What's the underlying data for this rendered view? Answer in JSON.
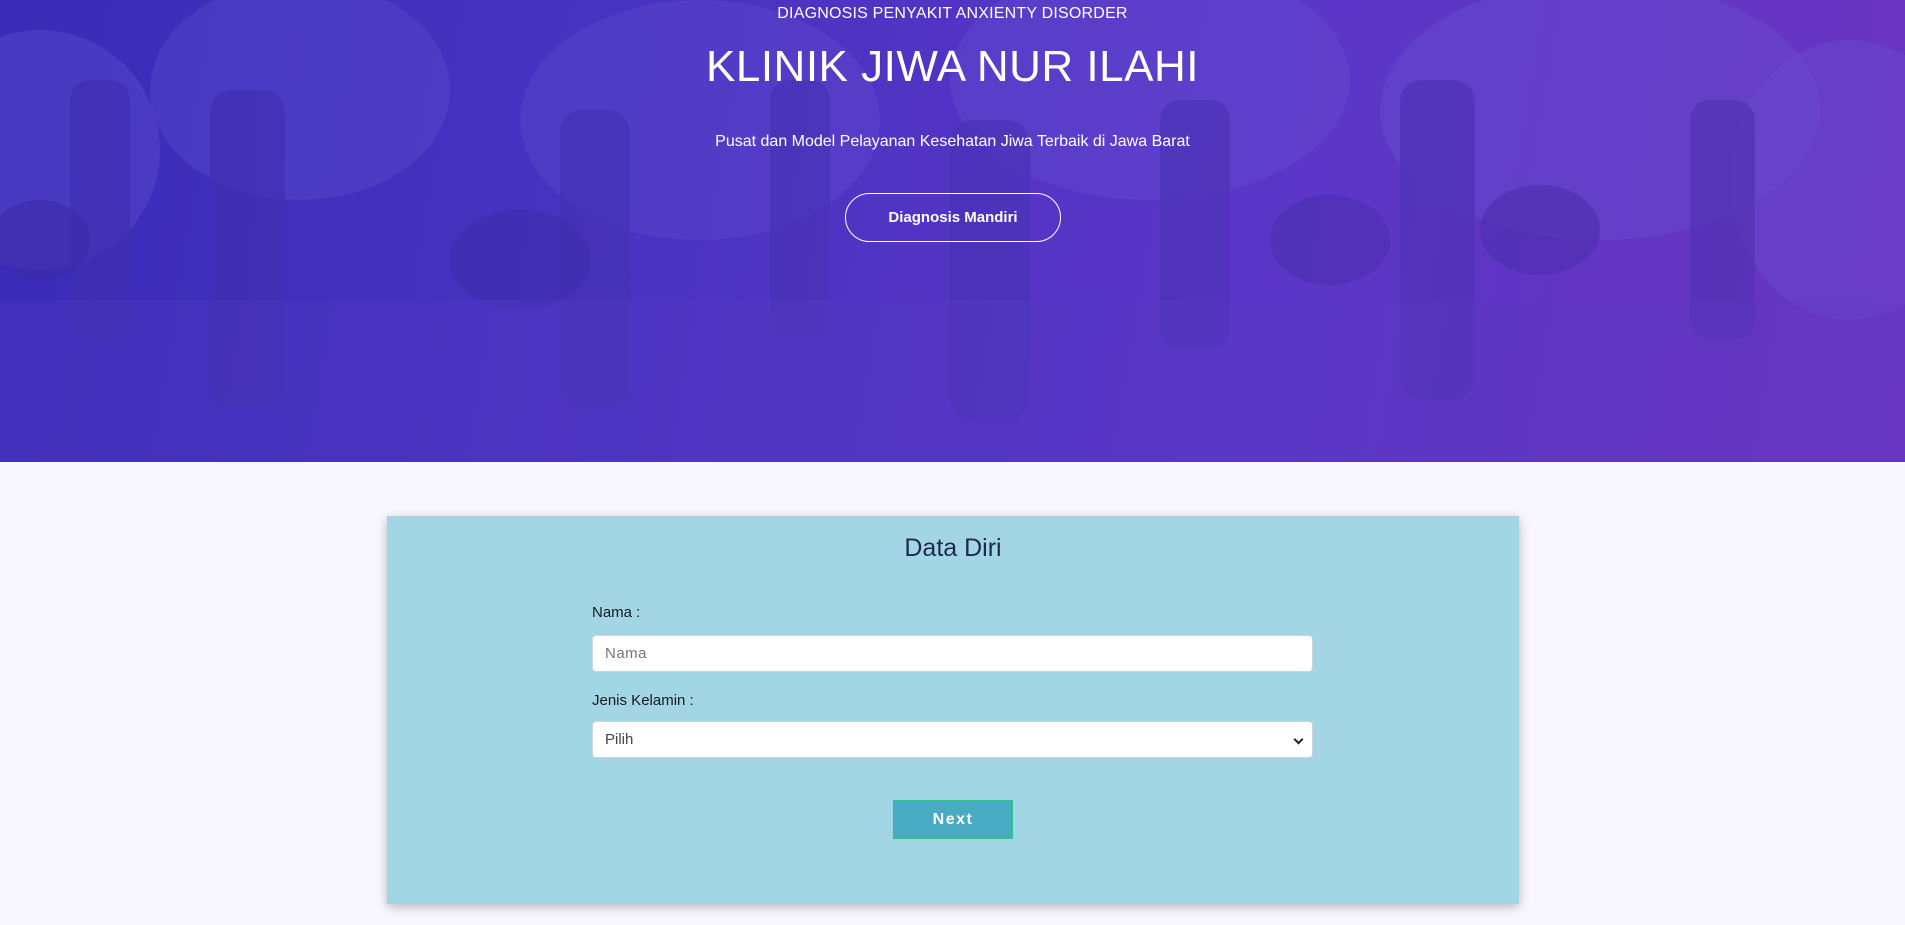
{
  "colors": {
    "hero_gradient_start": "#3b2bb8",
    "hero_gradient_end": "#6a34c0",
    "page_background": "#f8f7fd",
    "card_background": "#a3d6e4",
    "next_button": "#47abc3",
    "next_button_border": "#32c08a"
  },
  "hero": {
    "subtitle": "DIAGNOSIS PENYAKIT ANXIENTY DISORDER",
    "title": "KLINIK JIWA NUR ILAHI",
    "tagline": "Pusat dan Model Pelayanan Kesehatan Jiwa Terbaik di Jawa Barat",
    "cta_label": "Diagnosis Mandiri"
  },
  "form": {
    "title": "Data Diri",
    "nama": {
      "label": "Nama :",
      "placeholder": "Nama",
      "value": ""
    },
    "jenis_kelamin": {
      "label": "Jenis Kelamin :",
      "selected": "Pilih"
    },
    "next_label": "Next"
  }
}
